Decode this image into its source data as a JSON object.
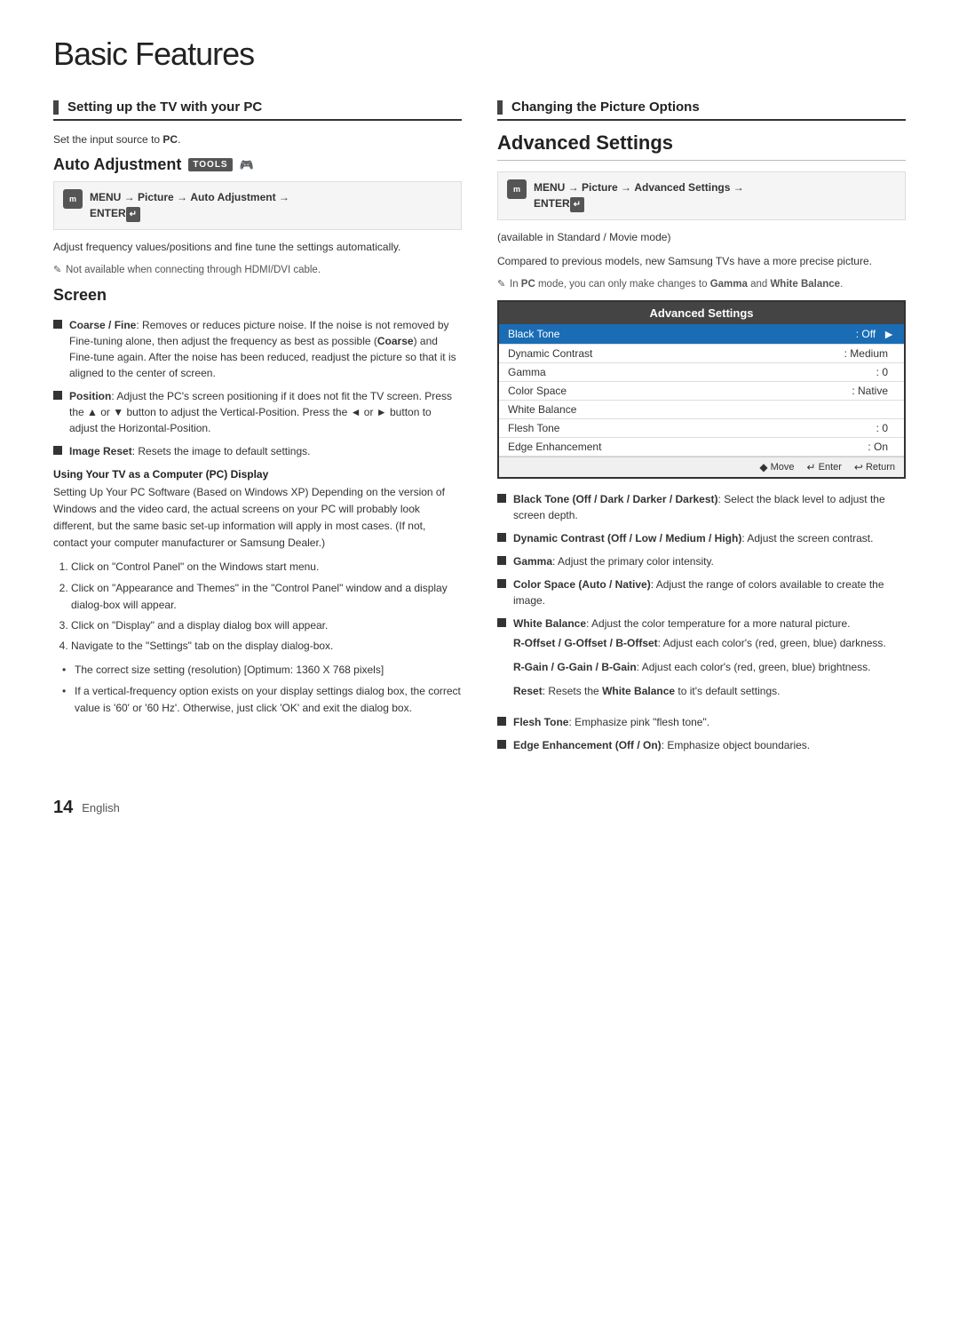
{
  "page": {
    "title": "Basic Features",
    "footer_number": "14",
    "footer_lang": "English"
  },
  "left": {
    "section_heading": "Setting up the TV with your PC",
    "intro": "Set the input source to PC.",
    "auto_adjustment": {
      "title": "Auto Adjustment",
      "tools_label": "TOOLS",
      "menu_path_line1": "MENU",
      "menu_path_line2": "→ Picture → Auto Adjustment →",
      "menu_path_line3": "ENTER",
      "description": "Adjust frequency values/positions and fine tune the settings automatically.",
      "note": "Not available when connecting through HDMI/DVI cable."
    },
    "screen": {
      "title": "Screen",
      "bullets": [
        {
          "label": "Coarse / Fine",
          "text": ": Removes or reduces picture noise. If the noise is not removed by Fine-tuning alone, then adjust the frequency as best as possible (Coarse) and Fine-tune again. After the noise has been reduced, readjust the picture so that it is aligned to the center of screen."
        },
        {
          "label": "Position",
          "text": ": Adjust the PC's screen positioning if it does not fit the TV screen. Press the ▲ or ▼ button to adjust the Vertical-Position. Press the ◄ or ► button to adjust the Horizontal-Position."
        },
        {
          "label": "Image Reset",
          "text": ": Resets the image to default settings."
        }
      ],
      "pc_display_heading": "Using Your TV as a Computer (PC) Display",
      "pc_display_body": "Setting Up Your PC Software (Based on Windows XP) Depending on the version of Windows and the video card, the actual screens on your PC will probably look different, but the same basic set-up information will apply in most cases. (If not, contact your computer manufacturer or Samsung Dealer.)",
      "numbered_steps": [
        "Click on \"Control Panel\" on the Windows start menu.",
        "Click on \"Appearance and Themes\" in the \"Control Panel\" window and a display dialog-box will appear.",
        "Click on \"Display\" and a display dialog box will appear.",
        "Navigate to the \"Settings\" tab on the display dialog-box."
      ],
      "dot_items": [
        "The correct size setting (resolution) [Optimum: 1360 X 768 pixels]",
        "If a vertical-frequency option exists on your display settings dialog box, the correct value is '60' or '60 Hz'. Otherwise, just click 'OK' and exit the dialog box."
      ]
    }
  },
  "right": {
    "section_heading": "Changing the Picture Options",
    "adv_settings": {
      "title": "Advanced Settings",
      "menu_path_line1": "MENU",
      "menu_path_line2": "→ Picture → Advanced Settings →",
      "menu_path_line3": "ENTER",
      "availability_note": "(available in Standard / Movie mode)",
      "description": "Compared to previous models, new Samsung TVs have a more precise picture.",
      "note": "In PC mode, you can only make changes to Gamma and White Balance.",
      "table_header": "Advanced Settings",
      "table_rows": [
        {
          "label": "Black Tone",
          "value": ": Off",
          "arrow": "►",
          "selected": true
        },
        {
          "label": "Dynamic Contrast",
          "value": ": Medium",
          "arrow": "",
          "selected": false
        },
        {
          "label": "Gamma",
          "value": ": 0",
          "arrow": "",
          "selected": false
        },
        {
          "label": "Color Space",
          "value": ": Native",
          "arrow": "",
          "selected": false
        },
        {
          "label": "White Balance",
          "value": "",
          "arrow": "",
          "selected": false
        },
        {
          "label": "Flesh Tone",
          "value": ": 0",
          "arrow": "",
          "selected": false
        },
        {
          "label": "Edge Enhancement",
          "value": ": On",
          "arrow": "",
          "selected": false
        }
      ],
      "footer_move": "◆ Move",
      "footer_enter": "↵ Enter",
      "footer_return": "↩ Return",
      "bullets": [
        {
          "label": "Black Tone (Off / Dark / Darker / Darkest)",
          "text": ": Select the black level to adjust the screen depth."
        },
        {
          "label": "Dynamic Contrast (Off / Low / Medium / High)",
          "text": ": Adjust the screen contrast."
        },
        {
          "label": "Gamma",
          "text": ": Adjust the primary color intensity."
        },
        {
          "label": "Color Space (Auto / Native)",
          "text": ": Adjust the range of colors available to create the image."
        },
        {
          "label": "White Balance",
          "text": ": Adjust the color temperature for a more natural picture.",
          "extra": [
            "R-Offset / G-Offset / B-Offset: Adjust each color's (red, green, blue) darkness.",
            "R-Gain / G-Gain / B-Gain: Adjust each color's (red, green, blue) brightness.",
            "Reset: Resets the White Balance to it's default settings."
          ]
        },
        {
          "label": "Flesh Tone",
          "text": ": Emphasize pink \"flesh tone\"."
        },
        {
          "label": "Edge Enhancement (Off / On)",
          "text": ": Emphasize object boundaries."
        }
      ]
    }
  }
}
